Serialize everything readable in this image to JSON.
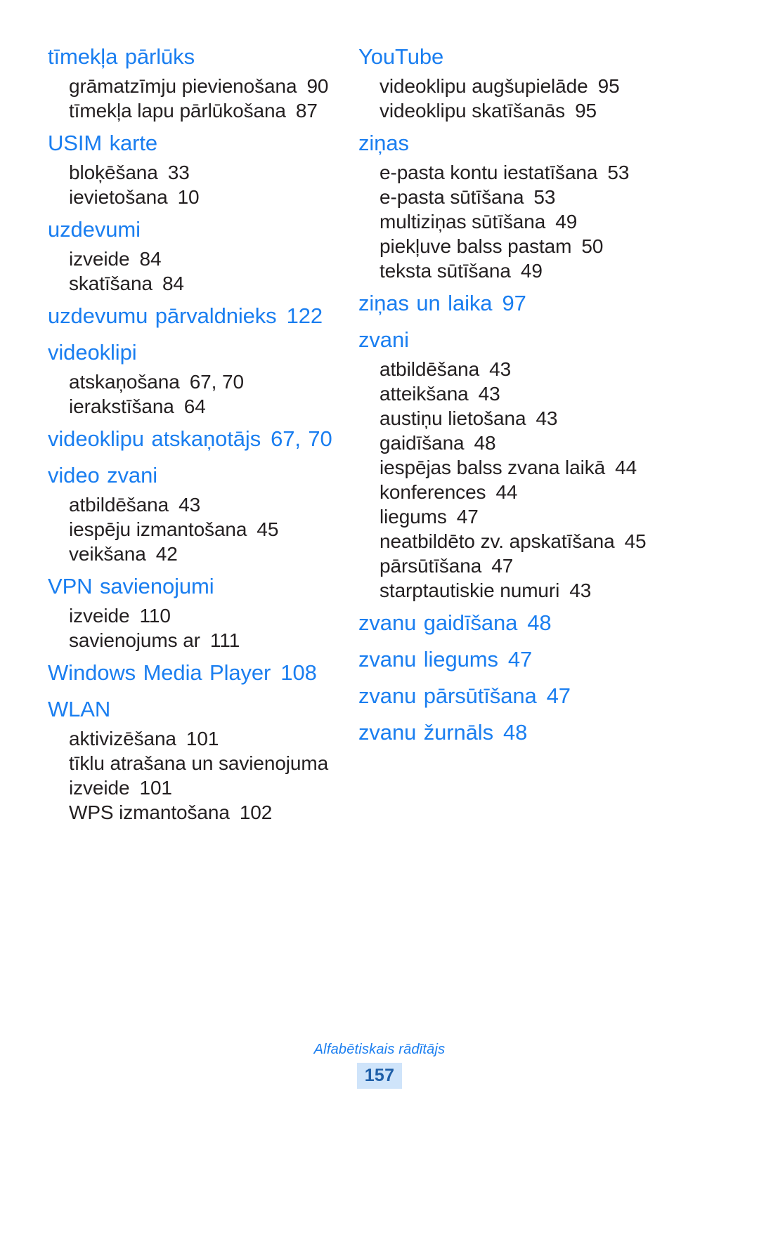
{
  "document": {
    "footer_label": "Alfabētiskais rādītājs",
    "page_number": "157",
    "heading_color": "#1a7ef0",
    "body_color": "#231f20",
    "badge_bg": "#cfe4fa"
  },
  "columns": [
    {
      "name": "left-column",
      "groups": [
        {
          "heading": "tīmekļa pārlūks",
          "heading_page": "",
          "entries": [
            {
              "label": "grāmatzīmju pievienošana",
              "page": "90"
            },
            {
              "label": "tīmekļa lapu pārlūkošana",
              "page": "87"
            }
          ]
        },
        {
          "heading": "USIM karte",
          "heading_page": "",
          "entries": [
            {
              "label": "bloķēšana",
              "page": "33"
            },
            {
              "label": "ievietošana",
              "page": "10"
            }
          ]
        },
        {
          "heading": "uzdevumi",
          "heading_page": "",
          "entries": [
            {
              "label": "izveide",
              "page": "84"
            },
            {
              "label": "skatīšana",
              "page": "84"
            }
          ]
        },
        {
          "heading": "uzdevumu pārvaldnieks",
          "heading_page": "122",
          "entries": []
        },
        {
          "heading": "videoklipi",
          "heading_page": "",
          "entries": [
            {
              "label": "atskaņošana",
              "page": "67, 70"
            },
            {
              "label": "ierakstīšana",
              "page": "64"
            }
          ]
        },
        {
          "heading": "videoklipu atskaņotājs",
          "heading_page": "67, 70",
          "entries": []
        },
        {
          "heading": "video zvani",
          "heading_page": "",
          "entries": [
            {
              "label": "atbildēšana",
              "page": "43"
            },
            {
              "label": "iespēju izmantošana",
              "page": "45"
            },
            {
              "label": "veikšana",
              "page": "42"
            }
          ]
        },
        {
          "heading": "VPN savienojumi",
          "heading_page": "",
          "entries": [
            {
              "label": "izveide",
              "page": "110"
            },
            {
              "label": "savienojums ar",
              "page": "111"
            }
          ]
        },
        {
          "heading": "Windows Media Player",
          "heading_page": "108",
          "entries": []
        },
        {
          "heading": "WLAN",
          "heading_page": "",
          "entries": [
            {
              "label": "aktivizēšana",
              "page": "101"
            },
            {
              "label": "tīklu atrašana un savienojuma izveide",
              "page": "101"
            },
            {
              "label": "WPS izmantošana",
              "page": "102"
            }
          ]
        }
      ]
    },
    {
      "name": "right-column",
      "groups": [
        {
          "heading": "YouTube",
          "heading_page": "",
          "entries": [
            {
              "label": "videoklipu augšupielāde",
              "page": "95"
            },
            {
              "label": "videoklipu skatīšanās",
              "page": "95"
            }
          ]
        },
        {
          "heading": "ziņas",
          "heading_page": "",
          "entries": [
            {
              "label": "e-pasta kontu iestatīšana",
              "page": "53"
            },
            {
              "label": "e-pasta sūtīšana",
              "page": "53"
            },
            {
              "label": "multiziņas sūtīšana",
              "page": "49"
            },
            {
              "label": "piekļuve balss pastam",
              "page": "50"
            },
            {
              "label": "teksta sūtīšana",
              "page": "49"
            }
          ]
        },
        {
          "heading": "ziņas un laika",
          "heading_page": "97",
          "entries": []
        },
        {
          "heading": "zvani",
          "heading_page": "",
          "entries": [
            {
              "label": "atbildēšana",
              "page": "43"
            },
            {
              "label": "atteikšana",
              "page": "43"
            },
            {
              "label": "austiņu lietošana",
              "page": "43"
            },
            {
              "label": "gaidīšana",
              "page": "48"
            },
            {
              "label": "iespējas balss zvana laikā",
              "page": "44"
            },
            {
              "label": "konferences",
              "page": "44"
            },
            {
              "label": "liegums",
              "page": "47"
            },
            {
              "label": "neatbildēto zv. apskatīšana",
              "page": "45"
            },
            {
              "label": "pārsūtīšana",
              "page": "47"
            },
            {
              "label": "starptautiskie numuri",
              "page": "43"
            }
          ]
        },
        {
          "heading": "zvanu gaidīšana",
          "heading_page": "48",
          "entries": []
        },
        {
          "heading": "zvanu liegums",
          "heading_page": "47",
          "entries": []
        },
        {
          "heading": "zvanu pārsūtīšana",
          "heading_page": "47",
          "entries": []
        },
        {
          "heading": "zvanu žurnāls",
          "heading_page": "48",
          "entries": []
        }
      ]
    }
  ]
}
